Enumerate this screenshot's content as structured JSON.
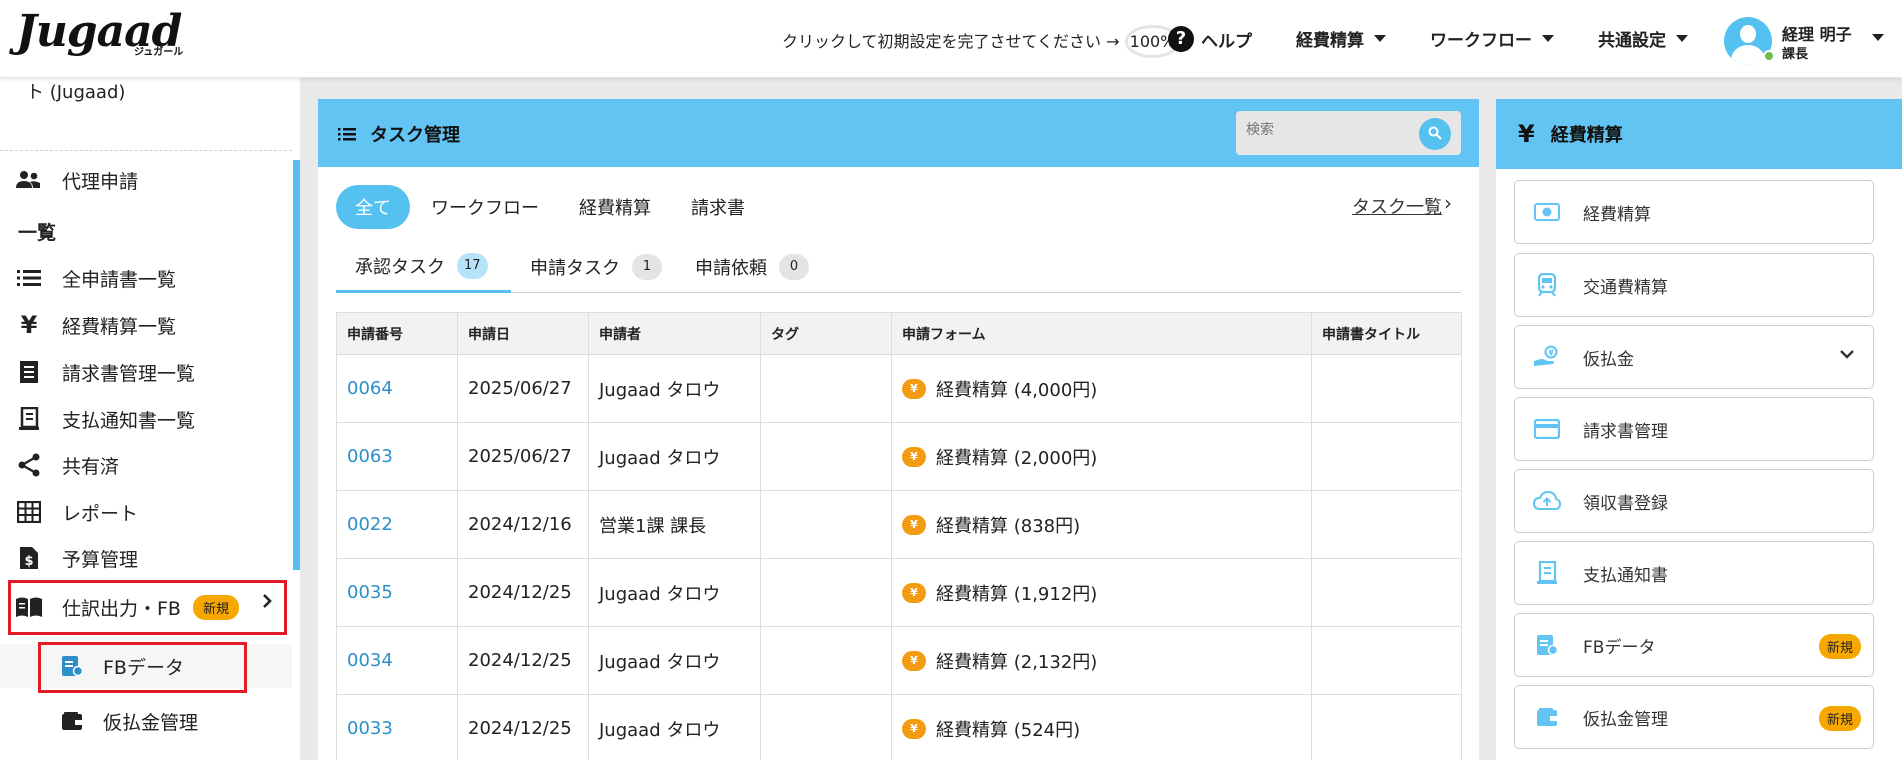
{
  "header": {
    "logo": "Jugaad",
    "logo_sub": "ジュガール",
    "setup_text": "クリックして初期設定を完了させてください →",
    "setup_progress": "100%",
    "help": "ヘルプ",
    "nav": [
      "経費精算",
      "ワークフロー",
      "共通設定"
    ],
    "user_name": "経理 明子",
    "user_role": "課長"
  },
  "sidebar": {
    "top_text": "ト (Jugaad)",
    "proxy": "代理申請",
    "heading": "一覧",
    "items": [
      "全申請書一覧",
      "経費精算一覧",
      "請求書管理一覧",
      "支払通知書一覧",
      "共有済",
      "レポート",
      "予算管理"
    ],
    "journal": "仕訳出力・FB",
    "new_badge": "新規",
    "sub_items": [
      "FBデータ",
      "仮払金管理"
    ]
  },
  "tasks": {
    "title": "タスク管理",
    "search_placeholder": "検索",
    "filters": [
      "全て",
      "ワークフロー",
      "経費精算",
      "請求書"
    ],
    "task_list_link": "タスク一覧",
    "tabs": [
      {
        "label": "承認タスク",
        "count": "17"
      },
      {
        "label": "申請タスク",
        "count": "1"
      },
      {
        "label": "申請依頼",
        "count": "0"
      }
    ],
    "columns": [
      "申請番号",
      "申請日",
      "申請者",
      "タグ",
      "申請フォーム",
      "申請書タイトル"
    ],
    "coin": "¥",
    "rows": [
      {
        "id": "0064",
        "date": "2025/06/27",
        "applicant": "Jugaad タロウ",
        "tag": "",
        "form": "経費精算 (4,000円)",
        "title": ""
      },
      {
        "id": "0063",
        "date": "2025/06/27",
        "applicant": "Jugaad タロウ",
        "tag": "",
        "form": "経費精算 (2,000円)",
        "title": ""
      },
      {
        "id": "0022",
        "date": "2024/12/16",
        "applicant": "営業1課 課長",
        "tag": "",
        "form": "経費精算 (838円)",
        "title": ""
      },
      {
        "id": "0035",
        "date": "2024/12/25",
        "applicant": "Jugaad タロウ",
        "tag": "",
        "form": "経費精算 (1,912円)",
        "title": ""
      },
      {
        "id": "0034",
        "date": "2024/12/25",
        "applicant": "Jugaad タロウ",
        "tag": "",
        "form": "経費精算 (2,132円)",
        "title": ""
      },
      {
        "id": "0033",
        "date": "2024/12/25",
        "applicant": "Jugaad タロウ",
        "tag": "",
        "form": "経費精算 (524円)",
        "title": ""
      }
    ]
  },
  "expense_panel": {
    "title": "経費精算",
    "yen": "¥",
    "buttons": [
      "経費精算",
      "交通費精算",
      "仮払金",
      "請求書管理",
      "領収書登録",
      "支払通知書",
      "FBデータ",
      "仮払金管理"
    ],
    "new_badge": "新規"
  },
  "colors": {
    "accent": "#55c1f0",
    "header_bar": "#62c4f2",
    "badge": "#f6a800",
    "highlight": "#e21b24",
    "link": "#2d8fc7"
  }
}
